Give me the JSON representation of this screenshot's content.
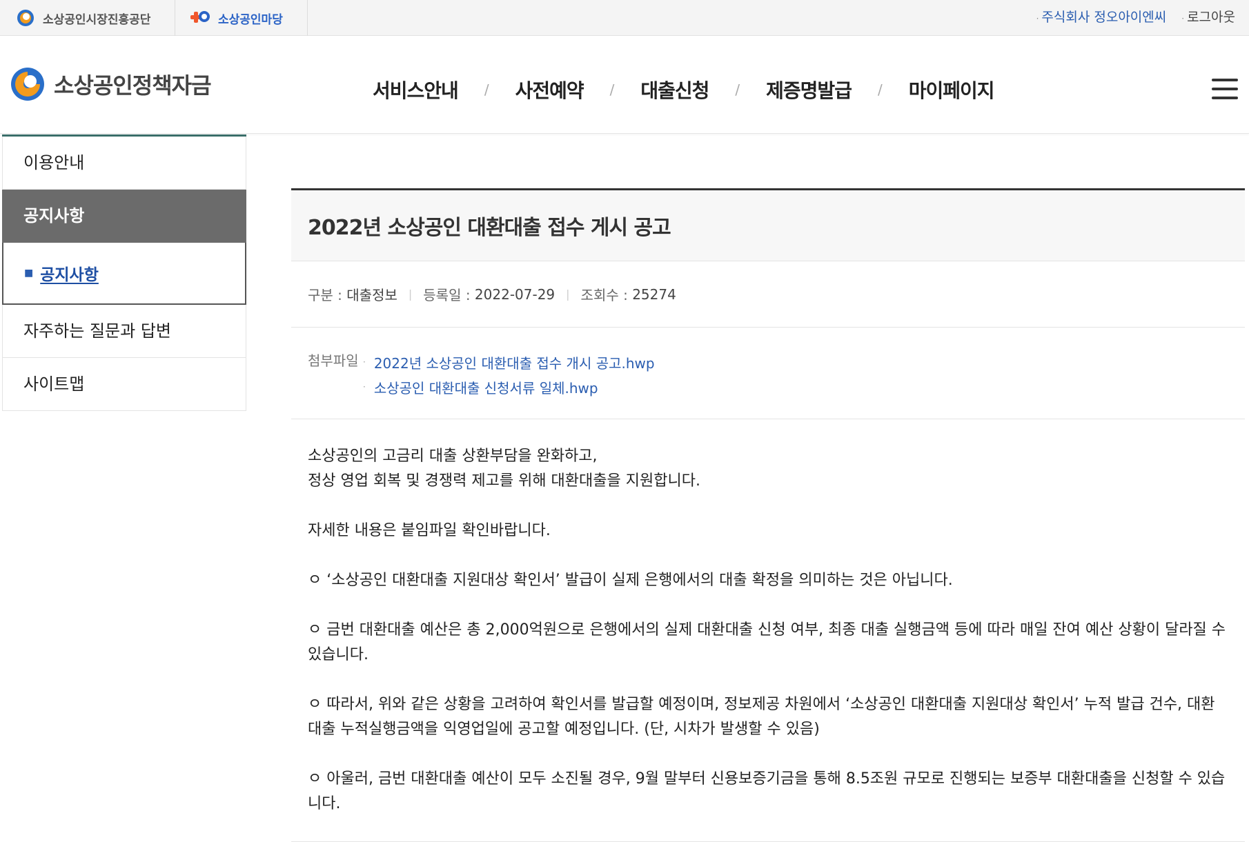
{
  "topbar": {
    "site1": "소상공인시장진흥공단",
    "site2": "소상공인마당",
    "user": "주식회사 정오아이엔씨",
    "logout": "로그아웃"
  },
  "header": {
    "brand": "소상공인정책자금",
    "menu": [
      "서비스안내",
      "사전예약",
      "대출신청",
      "제증명발급",
      "마이페이지"
    ],
    "separator": "/"
  },
  "sidebar": {
    "items": [
      {
        "label": "이용안내"
      },
      {
        "label": "공지사항"
      },
      {
        "label": "자주하는 질문과 답변"
      },
      {
        "label": "사이트맵"
      }
    ],
    "sub_item": "공지사항"
  },
  "post": {
    "title": "2022년 소상공인 대환대출 접수 게시 공고",
    "category_label": "구분 :",
    "category": "대출정보",
    "date_label": "등록일 :",
    "date": "2022-07-29",
    "views_label": "조회수 :",
    "views": "25274",
    "attach_label": "첨부파일",
    "attachments": [
      "2022년 소상공인 대환대출 접수 개시 공고.hwp",
      "소상공인 대환대출 신청서류 일체.hwp"
    ],
    "body": {
      "line1": "소상공인의 고금리 대출 상환부담을 완화하고,",
      "line2": "정상 영업 회복 및 경쟁력 제고를 위해 대환대출을 지원합니다.",
      "line3": "자세한 내용은 붙임파일 확인바랍니다.",
      "line4": "ㅇ ‘소상공인 대환대출 지원대상 확인서’ 발급이 실제 은행에서의 대출 확정을 의미하는 것은 아닙니다.",
      "line5": "ㅇ 금번 대환대출 예산은 총 2,000억원으로 은행에서의 실제 대환대출 신청 여부, 최종 대출 실행금액 등에 따라 매일 잔여 예산 상황이 달라질 수 있습니다.",
      "line6": "ㅇ 따라서, 위와 같은 상황을 고려하여 확인서를 발급할 예정이며, 정보제공 차원에서 ‘소상공인 대환대출 지원대상 확인서’ 누적 발급 건수, 대환대출 누적실행금액을 익영업일에 공고할 예정입니다. (단, 시차가 발생할 수 있음)",
      "line7": "ㅇ 아울러, 금번 대환대출 예산이 모두 소진될 경우, 9월 말부터 신용보증기금을 통해 8.5조원 규모로 진행되는 보증부 대환대출을 신청할 수 있습니다."
    }
  },
  "colors": {
    "logo_blue": "#2a6fc9",
    "logo_orange": "#f29b1d",
    "link_blue": "#2a5db0",
    "sidebar_active": "#6b6b6b"
  }
}
